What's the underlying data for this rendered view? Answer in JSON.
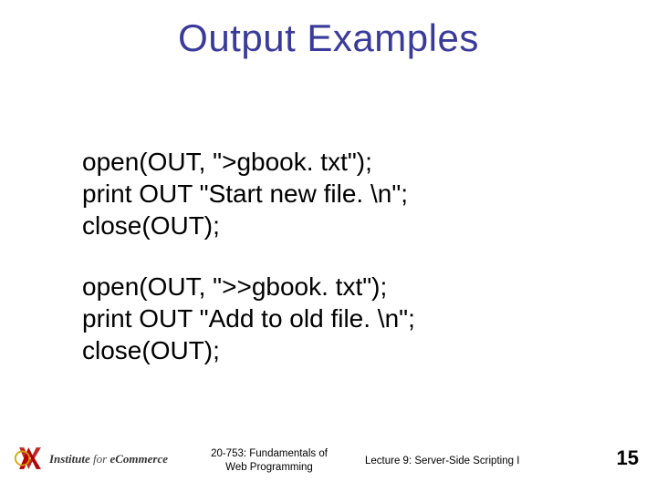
{
  "title": "Output Examples",
  "code_block_1": {
    "line1": "open(OUT, \">gbook. txt\");",
    "line2": "print OUT \"Start new file. \\n\";",
    "line3": "close(OUT);"
  },
  "code_block_2": {
    "line1": "open(OUT, \">>gbook. txt\");",
    "line2": "print OUT \"Add to old file. \\n\";",
    "line3": "close(OUT);"
  },
  "footer": {
    "logo_text_line1": "Institute",
    "logo_text_line2": " for ",
    "logo_text_line3": "eCommerce",
    "course_line1": "20-753: Fundamentals of",
    "course_line2": "Web Programming",
    "lecture": "Lecture 9: Server-Side Scripting I",
    "page": "15"
  }
}
